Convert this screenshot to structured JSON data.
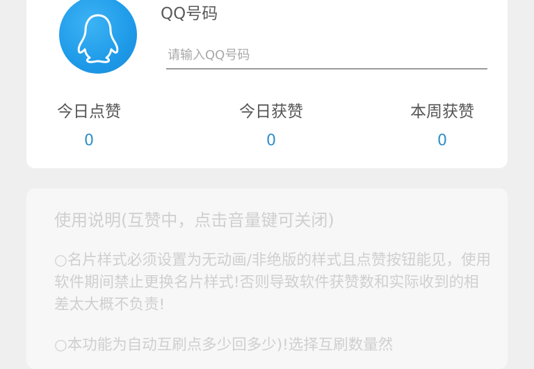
{
  "profile": {
    "avatar_icon": "qq-penguin-icon",
    "accent_color": "#1e9ae8",
    "qq_label": "QQ号码",
    "qq_input_placeholder": "请输入QQ号码",
    "qq_input_value": ""
  },
  "stats": [
    {
      "label": "今日点赞",
      "value": "0"
    },
    {
      "label": "今日获赞",
      "value": "0"
    },
    {
      "label": "本周获赞",
      "value": "0"
    }
  ],
  "usage": {
    "title": "使用说明(互赞中，点击音量键可关闭)",
    "paragraphs": [
      "○名片样式必须设置为无动画/非绝版的样式且点赞按钮能见，使用软件期间禁止更换名片样式!否则导致软件获赞数和实际收到的相差太大概不负责!",
      "○本功能为自动互刷点多少回多少)!选择互刷数量然"
    ]
  }
}
